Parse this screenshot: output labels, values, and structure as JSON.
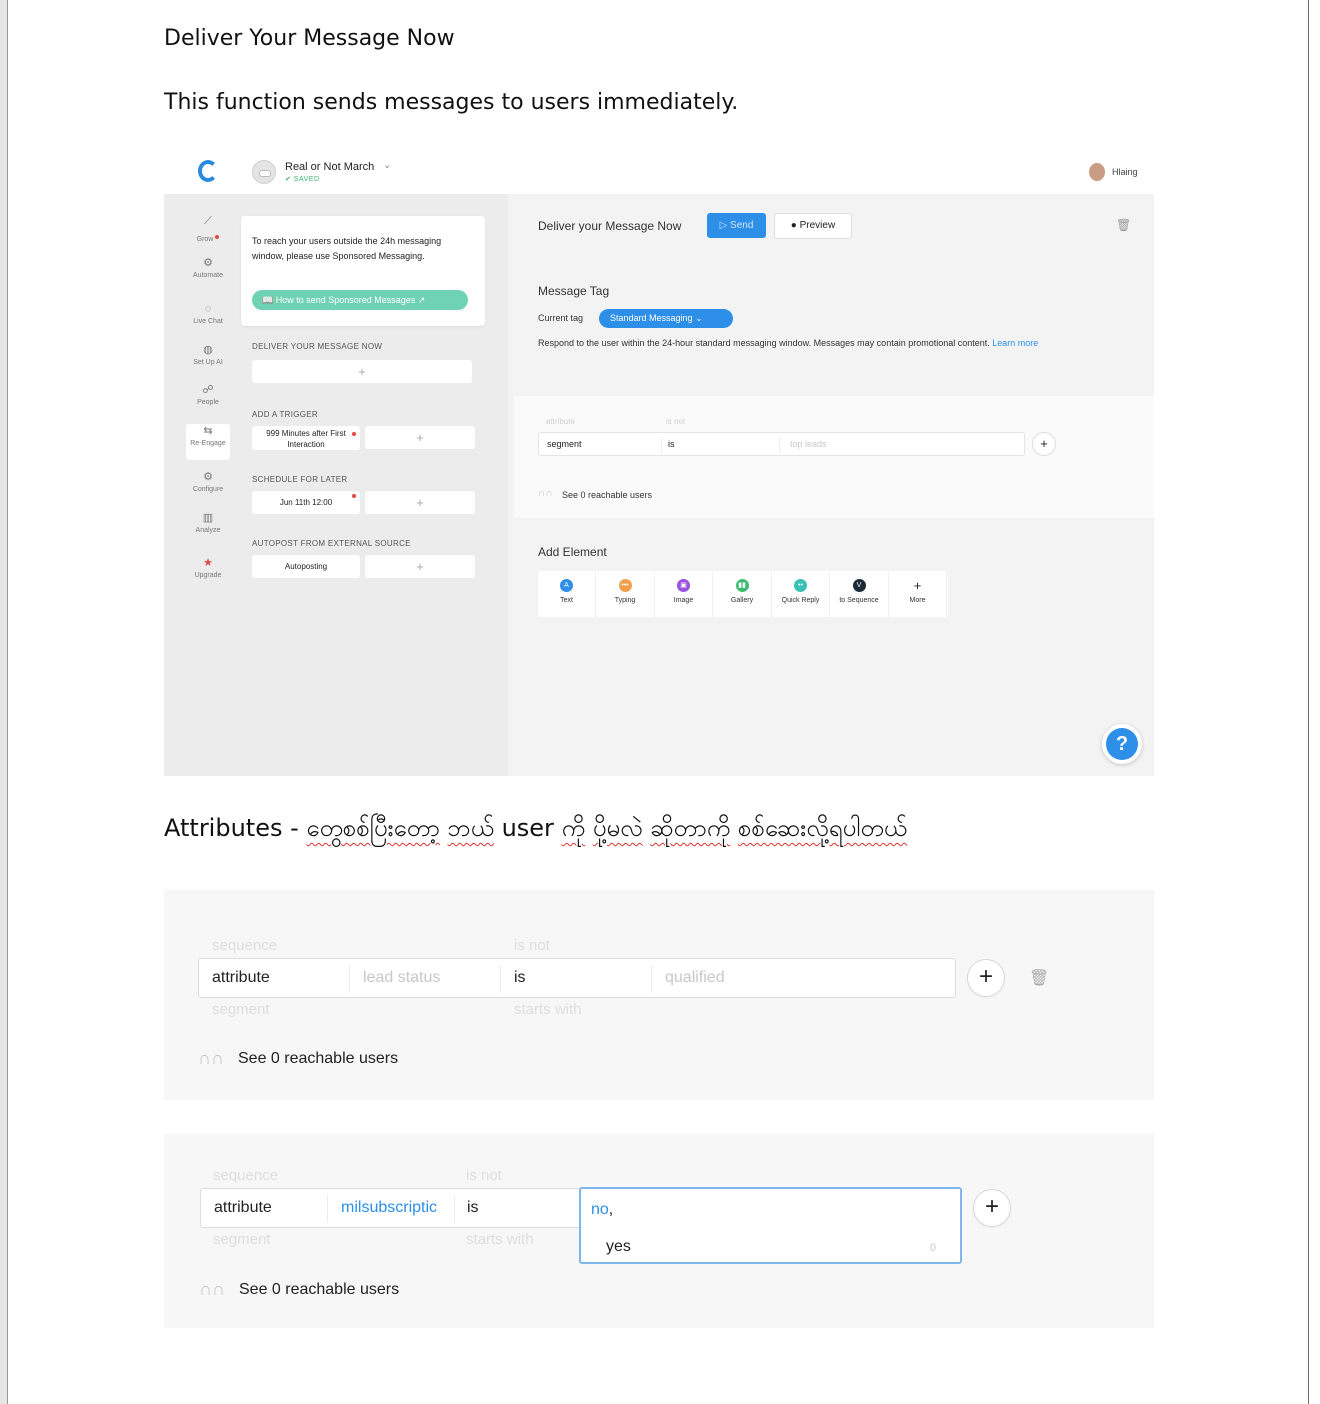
{
  "document": {
    "heading": "Deliver Your Message Now",
    "description": "This function sends messages to users immediately.",
    "attributes_heading_prefix": "Attributes - ",
    "attributes_heading_words": [
      "တွေစစ်ပြီးတော့",
      "ဘယ်",
      "user",
      "ကို",
      "ပို့မလဲ",
      "ဆိုတာကို",
      "စစ်ဆေးလို့ရပါတယ်"
    ]
  },
  "app": {
    "bot_name": "Real or Not March",
    "saved_label": "✔ SAVED",
    "user_name": "Hlaing",
    "sidebar": [
      {
        "label": "Grow",
        "icon": "grow-icon",
        "glyph": "⟋"
      },
      {
        "label": "Automate",
        "icon": "automate-icon",
        "glyph": "⚙"
      },
      {
        "label": "Live Chat",
        "icon": "chat-icon",
        "glyph": "◌"
      },
      {
        "label": "Set Up AI",
        "icon": "ai-icon",
        "glyph": "◍"
      },
      {
        "label": "People",
        "icon": "people-icon",
        "glyph": "☍"
      },
      {
        "label": "Re-Engage",
        "icon": "reengage-icon",
        "glyph": "⇆"
      },
      {
        "label": "Configure",
        "icon": "configure-icon",
        "glyph": "⚙"
      },
      {
        "label": "Analyze",
        "icon": "analyze-icon",
        "glyph": "▥"
      },
      {
        "label": "Upgrade",
        "icon": "star-icon",
        "glyph": "★"
      }
    ],
    "info_text": "To reach your users outside the 24h messaging window, please use Sponsored Messaging.",
    "howto_button": "📖  How to send Sponsored Messages ↗",
    "sections": {
      "deliver": "DELIVER YOUR MESSAGE NOW",
      "trigger": "ADD A TRIGGER",
      "trigger_value": "999 Minutes after First Interaction",
      "schedule": "SCHEDULE FOR LATER",
      "schedule_value": "Jun 11th 12:00",
      "autopost": "AUTOPOST FROM EXTERNAL SOURCE",
      "autopost_value": "Autoposting"
    },
    "main": {
      "title": "Deliver your Message Now",
      "send_label": "▷ Send",
      "preview_label": "Preview",
      "message_tag_title": "Message Tag",
      "current_tag_label": "Current tag",
      "current_tag_value": "Standard Messaging",
      "tag_description": "Respond to the user within the 24-hour standard messaging window. Messages may contain promotional content.",
      "learn_more": "Learn more",
      "filter": {
        "ghost_attribute": "attribute",
        "ghost_is_not": "is not",
        "field": "segment",
        "operator": "is",
        "value_placeholder": "top leads"
      },
      "reachable": "See 0 reachable users",
      "add_element_title": "Add Element",
      "elements": [
        {
          "label": "Text",
          "glyph": "A",
          "color": "#2d8fe8"
        },
        {
          "label": "Typing",
          "glyph": "•••",
          "color": "#f0a04b"
        },
        {
          "label": "Image",
          "glyph": "▣",
          "color": "#9b51e0"
        },
        {
          "label": "Gallery",
          "glyph": "▮▮",
          "color": "#3dbb6f"
        },
        {
          "label": "Quick Reply",
          "glyph": "••",
          "color": "#39c0b5"
        },
        {
          "label": "to Sequence",
          "glyph": "V",
          "color": "#1d2a3a"
        },
        {
          "label": "More",
          "glyph": "+",
          "color": "#ffffff"
        }
      ]
    }
  },
  "filter_block_1": {
    "ghost_top_left": "sequence",
    "ghost_top_mid": "is not",
    "ghost_bottom_left": "segment",
    "ghost_bottom_mid": "starts with",
    "field": "attribute",
    "attribute_placeholder": "lead status",
    "operator": "is",
    "value_placeholder": "qualified",
    "reachable": "See 0 reachable users"
  },
  "filter_block_2": {
    "ghost_top_left": "sequence",
    "ghost_top_mid": "is not",
    "ghost_bottom_left": "segment",
    "ghost_bottom_mid": "starts with",
    "field": "attribute",
    "attribute_value": "milsubscriptic",
    "operator": "is",
    "selected_value": "no",
    "option_yes": "yes",
    "option_count": "0",
    "reachable": "See 0 reachable users"
  }
}
